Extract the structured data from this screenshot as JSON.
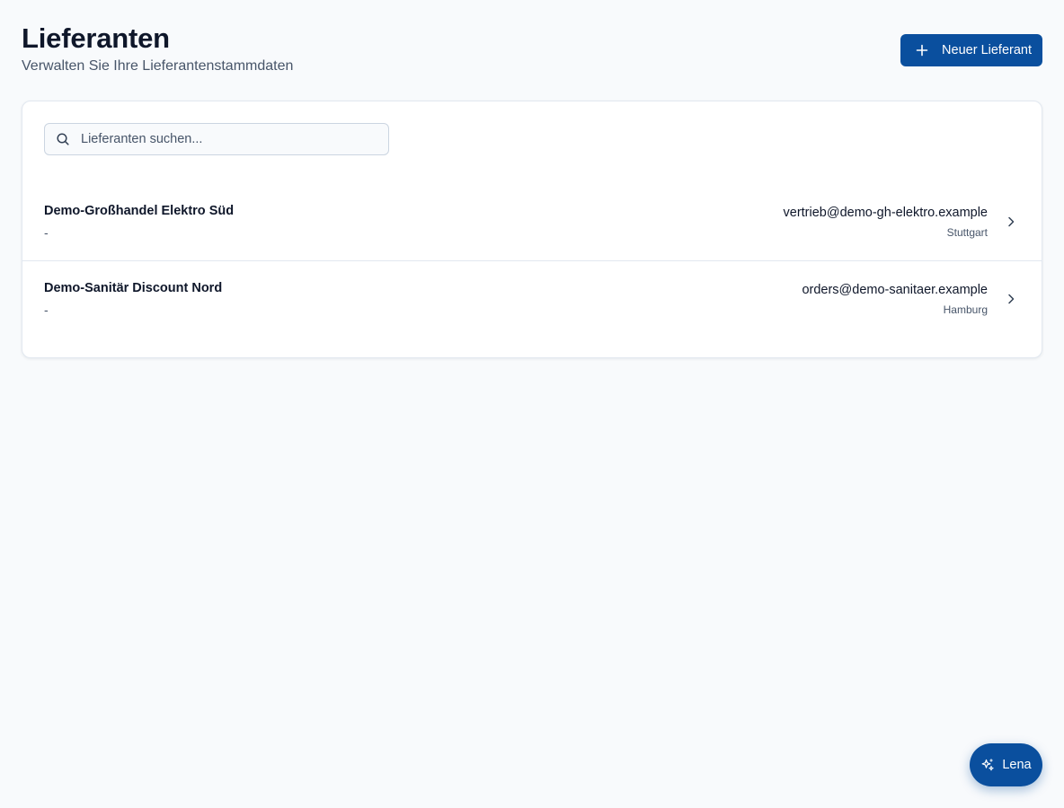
{
  "header": {
    "title": "Lieferanten",
    "subtitle": "Verwalten Sie Ihre Lieferantenstammdaten",
    "new_button_label": "Neuer Lieferant"
  },
  "search": {
    "placeholder": "Lieferanten suchen...",
    "value": ""
  },
  "suppliers": [
    {
      "name": "Demo-Großhandel Elektro Süd",
      "subline": "-",
      "email": "vertrieb@demo-gh-elektro.example",
      "city": "Stuttgart"
    },
    {
      "name": "Demo-Sanitär Discount Nord",
      "subline": "-",
      "email": "orders@demo-sanitaer.example",
      "city": "Hamburg"
    }
  ],
  "assistant": {
    "label": "Lena",
    "icon": "sparkles-icon"
  },
  "colors": {
    "accent": "#0a4f9e",
    "background": "#f8fafc",
    "card": "#ffffff",
    "border": "#e2e8f0",
    "muted_text": "#475569"
  },
  "icons": {
    "new_button": "plus-icon",
    "search": "search-icon",
    "row_action": "chevron-right-icon"
  }
}
